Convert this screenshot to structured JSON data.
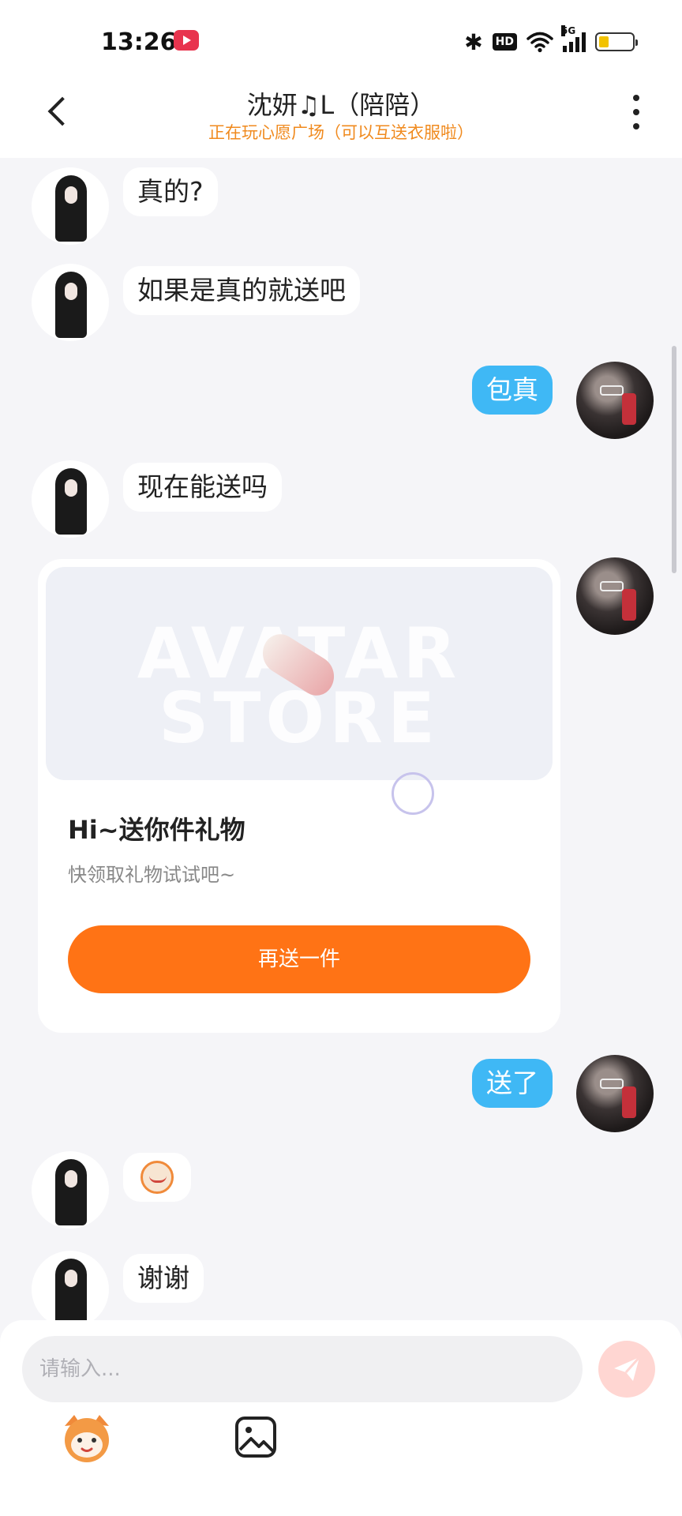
{
  "status_bar": {
    "time": "13:26",
    "network": "5G"
  },
  "header": {
    "title": "沈妍♫L（陪陪）",
    "subtitle": "正在玩心愿广场（可以互送衣服啦）"
  },
  "messages": [
    {
      "from": "her",
      "text": "真的?"
    },
    {
      "from": "her",
      "text": "如果是真的就送吧"
    },
    {
      "from": "me",
      "text": "包真"
    },
    {
      "from": "her",
      "text": "现在能送吗"
    },
    {
      "from": "me",
      "type": "gift_card"
    },
    {
      "from": "me",
      "text": "送了"
    },
    {
      "from": "her",
      "type": "sticker"
    },
    {
      "from": "her",
      "text": "谢谢"
    }
  ],
  "gift_card": {
    "watermark_top": "AVATAR",
    "watermark_bottom": "STORE",
    "title": "Hi~送你件礼物",
    "description": "快领取礼物试试吧~",
    "button_label": "再送一件"
  },
  "input": {
    "placeholder": "请输入..."
  },
  "colors": {
    "accent_orange": "#ff7315",
    "sent_bubble": "#3fb8f5",
    "subtitle_orange": "#f08a1e"
  },
  "icons": {
    "back": "chevron-left-icon",
    "more": "more-vertical-icon",
    "send": "send-icon",
    "emoji": "emoji-icon",
    "image": "image-icon"
  }
}
